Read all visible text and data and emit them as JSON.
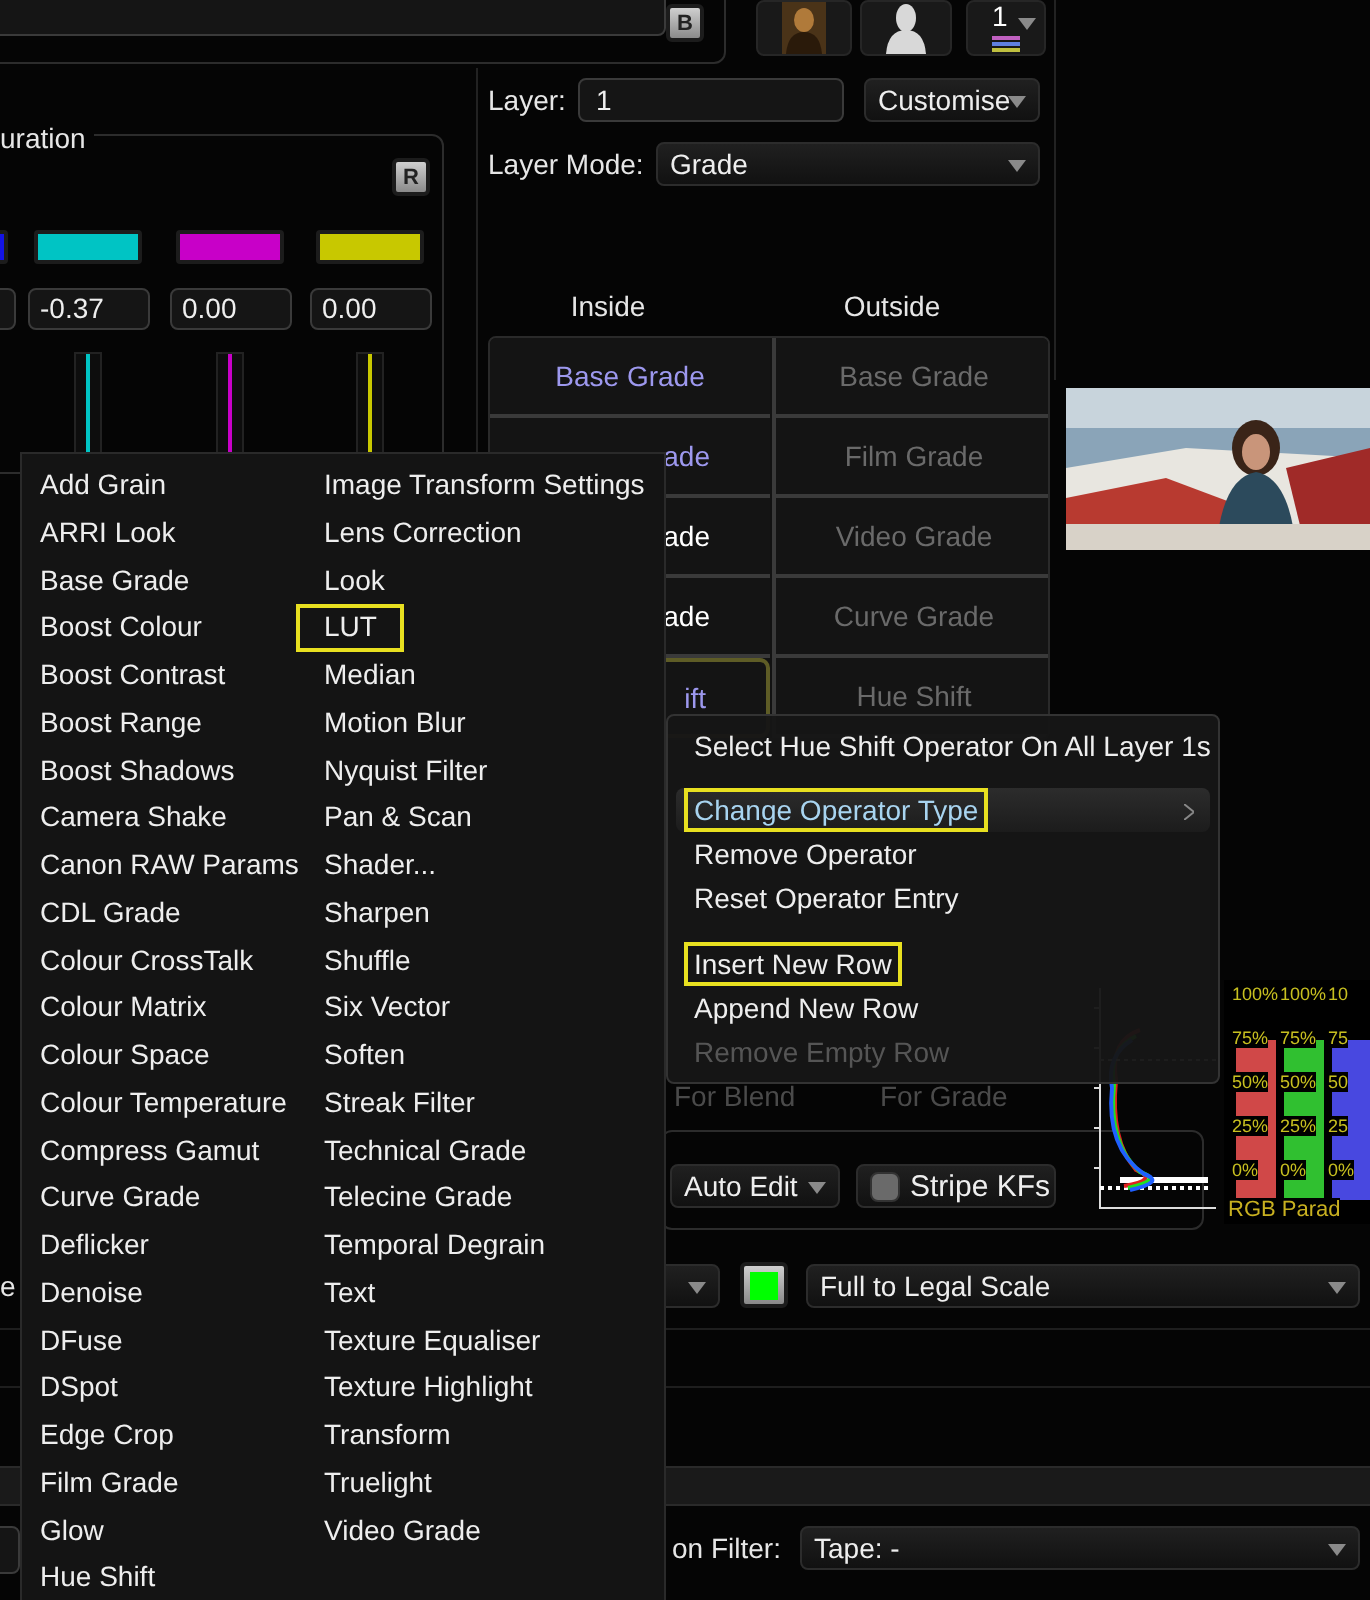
{
  "top_bar": {
    "b_button": "B",
    "layer_count": "1"
  },
  "saturation_panel": {
    "title": "uration",
    "reset_button": "R",
    "channels": [
      {
        "color": "#1414e6"
      },
      {
        "color": "#00c4c4",
        "value": "-0.37"
      },
      {
        "color": "#c800c8",
        "value": "0.00"
      },
      {
        "color": "#c8c800",
        "value": "0.00"
      }
    ]
  },
  "layer": {
    "label": "Layer:",
    "value": "1",
    "menu": "Customise"
  },
  "layer_mode": {
    "label": "Layer Mode:",
    "value": "Grade"
  },
  "grade_table": {
    "columns": [
      "Inside",
      "Outside"
    ],
    "rows": [
      {
        "inside": "Base Grade",
        "inside_active": true,
        "outside": "Base Grade",
        "selected": false
      },
      {
        "inside": "ade",
        "inside_active": true,
        "outside": "Film Grade",
        "selected": false
      },
      {
        "inside": "ade",
        "inside_active": false,
        "outside": "Video Grade",
        "selected": false
      },
      {
        "inside": "ade",
        "inside_active": false,
        "outside": "Curve Grade",
        "selected": false
      },
      {
        "inside": "ift",
        "inside_active": true,
        "outside": "Hue Shift",
        "selected": true
      }
    ]
  },
  "context_menu": [
    {
      "label": "Select Hue Shift Operator On All Layer 1s",
      "selected": false,
      "highlighted": false,
      "disabled": false,
      "submenu": false,
      "separator_after": true
    },
    {
      "label": "Change Operator Type",
      "selected": true,
      "highlighted": true,
      "disabled": false,
      "submenu": true,
      "separator_after": false
    },
    {
      "label": "Remove Operator",
      "selected": false,
      "highlighted": false,
      "disabled": false,
      "submenu": false,
      "separator_after": false
    },
    {
      "label": "Reset Operator Entry",
      "selected": false,
      "highlighted": false,
      "disabled": false,
      "submenu": false,
      "separator_after": true
    },
    {
      "label": "Insert New Row",
      "selected": false,
      "highlighted": true,
      "disabled": false,
      "submenu": false,
      "separator_after": false
    },
    {
      "label": "Append New Row",
      "selected": false,
      "highlighted": false,
      "disabled": false,
      "submenu": false,
      "separator_after": false
    },
    {
      "label": "Remove Empty Row",
      "selected": false,
      "highlighted": false,
      "disabled": true,
      "submenu": false,
      "separator_after": false
    }
  ],
  "behind_menu": [
    "For Blend",
    "For Grade"
  ],
  "edit_controls": {
    "auto_edit": "Auto Edit",
    "stripe_kfs": {
      "label": "Stripe KFs",
      "on": false
    }
  },
  "rgb_parade": {
    "title": "RGB Parad",
    "columns": [
      {
        "color": "#d04848",
        "labels": [
          "100%",
          "75%",
          "50%",
          "25%",
          "0%"
        ]
      },
      {
        "color": "#30c030",
        "labels": [
          "100%",
          "75%",
          "50%",
          "25%",
          "0%"
        ]
      },
      {
        "color": "#4848e0",
        "labels": [
          "10",
          "75",
          "50",
          "25",
          "0%"
        ]
      }
    ]
  },
  "scale_row": {
    "cut_label": "e",
    "swatch": {
      "color": "#00ff00"
    },
    "scale": "Full to Legal Scale"
  },
  "filter_row": {
    "label": "on Filter:",
    "value": "Tape: -"
  },
  "operator_menu": {
    "columns": [
      [
        {
          "label": "Add Grain",
          "highlighted": false
        },
        {
          "label": "ARRI Look",
          "highlighted": false
        },
        {
          "label": "Base Grade",
          "highlighted": false
        },
        {
          "label": "Boost Colour",
          "highlighted": false
        },
        {
          "label": "Boost Contrast",
          "highlighted": false
        },
        {
          "label": "Boost Range",
          "highlighted": false
        },
        {
          "label": "Boost Shadows",
          "highlighted": false
        },
        {
          "label": "Camera Shake",
          "highlighted": false
        },
        {
          "label": "Canon RAW Params",
          "highlighted": false
        },
        {
          "label": "CDL Grade",
          "highlighted": false
        },
        {
          "label": "Colour CrossTalk",
          "highlighted": false
        },
        {
          "label": "Colour Matrix",
          "highlighted": false
        },
        {
          "label": "Colour Space",
          "highlighted": false
        },
        {
          "label": "Colour Temperature",
          "highlighted": false
        },
        {
          "label": "Compress Gamut",
          "highlighted": false
        },
        {
          "label": "Curve Grade",
          "highlighted": false
        },
        {
          "label": "Deflicker",
          "highlighted": false
        },
        {
          "label": "Denoise",
          "highlighted": false
        },
        {
          "label": "DFuse",
          "highlighted": false
        },
        {
          "label": "DSpot",
          "highlighted": false
        },
        {
          "label": "Edge Crop",
          "highlighted": false
        },
        {
          "label": "Film Grade",
          "highlighted": false
        },
        {
          "label": "Glow",
          "highlighted": false
        },
        {
          "label": "Hue Shift",
          "highlighted": false
        }
      ],
      [
        {
          "label": "Image Transform Settings",
          "highlighted": false
        },
        {
          "label": "Lens Correction",
          "highlighted": false
        },
        {
          "label": "Look",
          "highlighted": false
        },
        {
          "label": "LUT",
          "highlighted": true
        },
        {
          "label": "Median",
          "highlighted": false
        },
        {
          "label": "Motion Blur",
          "highlighted": false
        },
        {
          "label": "Nyquist Filter",
          "highlighted": false
        },
        {
          "label": "Pan & Scan",
          "highlighted": false
        },
        {
          "label": "Shader...",
          "highlighted": false
        },
        {
          "label": "Sharpen",
          "highlighted": false
        },
        {
          "label": "Shuffle",
          "highlighted": false
        },
        {
          "label": "Six Vector",
          "highlighted": false
        },
        {
          "label": "Soften",
          "highlighted": false
        },
        {
          "label": "Streak Filter",
          "highlighted": false
        },
        {
          "label": "Technical Grade",
          "highlighted": false
        },
        {
          "label": "Telecine Grade",
          "highlighted": false
        },
        {
          "label": "Temporal Degrain",
          "highlighted": false
        },
        {
          "label": "Text",
          "highlighted": false
        },
        {
          "label": "Texture Equaliser",
          "highlighted": false
        },
        {
          "label": "Texture Highlight",
          "highlighted": false
        },
        {
          "label": "Transform",
          "highlighted": false
        },
        {
          "label": "Truelight",
          "highlighted": false
        },
        {
          "label": "Video Grade",
          "highlighted": false
        }
      ]
    ]
  }
}
